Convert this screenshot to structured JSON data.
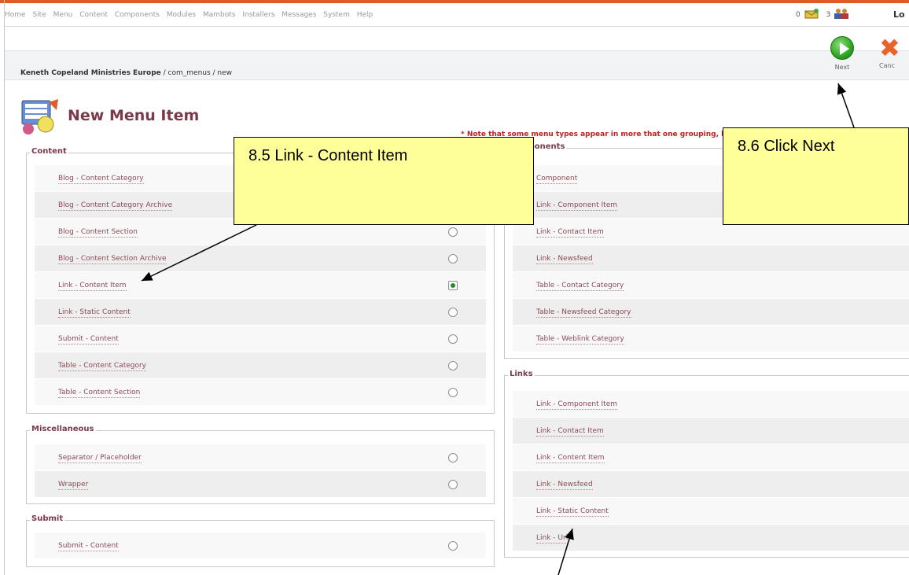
{
  "topmenu": {
    "items": [
      "Home",
      "Site",
      "Menu",
      "Content",
      "Components",
      "Modules",
      "Mambots",
      "Installers",
      "Messages",
      "System",
      "Help"
    ],
    "messages_count": "0",
    "users_count": "3",
    "logout_label": "Lo"
  },
  "pathbar": {
    "site": "Keneth Copeland Ministries Europe",
    "path": " / com_menus / new"
  },
  "toolbar": {
    "next_label": "Next",
    "cancel_label": "Canc"
  },
  "page": {
    "title": "New Menu Item",
    "note": "* Note that some menu types appear in more that one grouping, but they are still the same menu type."
  },
  "content_group": {
    "legend": "Content",
    "items": [
      {
        "label": "Blog - Content Category",
        "checked": false
      },
      {
        "label": "Blog - Content Category Archive",
        "checked": false
      },
      {
        "label": "Blog - Content Section",
        "checked": false
      },
      {
        "label": "Blog - Content Section Archive",
        "checked": false
      },
      {
        "label": "Link - Content Item",
        "checked": true
      },
      {
        "label": "Link - Static Content",
        "checked": false
      },
      {
        "label": "Submit - Content",
        "checked": false
      },
      {
        "label": "Table - Content Category",
        "checked": false
      },
      {
        "label": "Table - Content Section",
        "checked": false
      }
    ]
  },
  "misc_group": {
    "legend": "Miscellaneous",
    "items": [
      {
        "label": "Separator / Placeholder",
        "checked": false
      },
      {
        "label": "Wrapper",
        "checked": false
      }
    ]
  },
  "submit_group": {
    "legend": "Submit",
    "items": [
      {
        "label": "Submit - Content",
        "checked": false
      }
    ]
  },
  "components_group": {
    "legend": "Components",
    "items": [
      {
        "label": "Component"
      },
      {
        "label": "Link - Component Item"
      },
      {
        "label": "Link - Contact Item"
      },
      {
        "label": "Link - Newsfeed"
      },
      {
        "label": "Table - Contact Category"
      },
      {
        "label": "Table - Newsfeed Category"
      },
      {
        "label": "Table - Weblink Category"
      }
    ]
  },
  "links_group": {
    "legend": "Links",
    "items": [
      {
        "label": "Link - Component Item"
      },
      {
        "label": "Link - Contact Item"
      },
      {
        "label": "Link - Content Item"
      },
      {
        "label": "Link - Newsfeed"
      },
      {
        "label": "Link - Static Content"
      },
      {
        "label": "Link - Url"
      }
    ]
  },
  "callouts": {
    "content_item": "8.5 Link - Content Item",
    "click_next": "8.6 Click Next"
  },
  "colors": {
    "accent": "#7b3a4a",
    "callout_bg": "#ffff99",
    "topline": "#e05a2a"
  }
}
